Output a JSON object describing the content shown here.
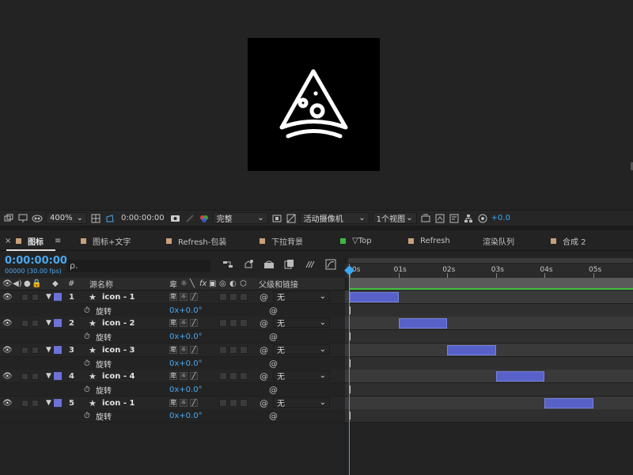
{
  "viewer_bar": {
    "zoom": "400%",
    "timecode": "0:00:00:00",
    "resolution": "完整",
    "camera": "活动摄像机",
    "views": "1个视图",
    "exposure": "+0.0"
  },
  "tabs": [
    {
      "label": "图标",
      "color": "#c8a07a"
    },
    {
      "label": "图标+文字",
      "color": "#c8a07a"
    },
    {
      "label": "Refresh-包装",
      "color": "#c8a07a"
    },
    {
      "label": "下拉背景",
      "color": "#c8a07a"
    },
    {
      "label": "▽Top",
      "color": "#3fb63f"
    },
    {
      "label": "Refresh",
      "color": "#c8a07a"
    },
    {
      "label": "渲染队列",
      "color": ""
    },
    {
      "label": "合成 2",
      "color": "#c8a07a"
    }
  ],
  "close_glyph": "×",
  "comp": {
    "timecode": "0:00:00:00",
    "fps": "00000 (30.00 fps)",
    "search_placeholder": "ρ."
  },
  "columns": {
    "number": "#",
    "source_name": "源名称",
    "parent": "父级和链接"
  },
  "layers": [
    {
      "num": "1",
      "name": "icon - 1",
      "parent": "无",
      "prop": "旋转",
      "value": "0x+0.0°",
      "bar_start": 0,
      "bar_end": 1
    },
    {
      "num": "2",
      "name": "icon - 2",
      "parent": "无",
      "prop": "旋转",
      "value": "0x+0.0°",
      "bar_start": 1,
      "bar_end": 2
    },
    {
      "num": "3",
      "name": "icon - 3",
      "parent": "无",
      "prop": "旋转",
      "value": "0x+0.0°",
      "bar_start": 2,
      "bar_end": 3
    },
    {
      "num": "4",
      "name": "icon - 4",
      "parent": "无",
      "prop": "旋转",
      "value": "0x+0.0°",
      "bar_start": 3,
      "bar_end": 4
    },
    {
      "num": "5",
      "name": "icon - 1",
      "parent": "无",
      "prop": "旋转",
      "value": "0x+0.0°",
      "bar_start": 4,
      "bar_end": 5
    }
  ],
  "ruler_labels": [
    "0s",
    "01s",
    "02s",
    "03s",
    "04s",
    "05s"
  ],
  "colors": {
    "accent": "#4aa8ef",
    "layer_label": "#6b72d8",
    "layer_bar": "#5861c8",
    "work_area_green": "#44c13f"
  }
}
